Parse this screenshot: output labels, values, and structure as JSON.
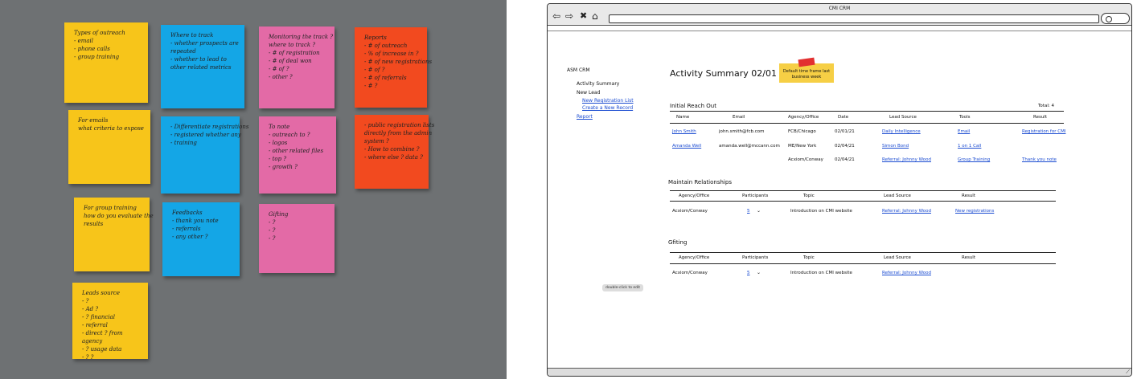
{
  "photo": {
    "notes": [
      {
        "color": "yellow",
        "lines": [
          "Types of outreach",
          "- email",
          "- phone calls",
          "- group training"
        ]
      },
      {
        "color": "blue",
        "lines": [
          "Where to track",
          "- whether prospects are",
          "  repeated",
          "- whether to lead to",
          "  other related metrics"
        ]
      },
      {
        "color": "pink",
        "lines": [
          "Monitoring the track ?",
          "where to track ?",
          "- # of registration",
          "- # of deal won",
          "- # of ?",
          "- other ?"
        ]
      },
      {
        "color": "red",
        "lines": [
          "Reports",
          "- # of outreach",
          "- % of increase in ?",
          "- # of new registrations",
          "- # of ?",
          "- # of referrals",
          "- # ?"
        ]
      },
      {
        "color": "yellow",
        "lines": [
          "For emails",
          "what criteria to expose"
        ]
      },
      {
        "color": "blue",
        "lines": [
          "- Differentiate registrations",
          "- registered whether any",
          "- training"
        ]
      },
      {
        "color": "pink",
        "lines": [
          "To note",
          "- outreach to ?",
          "- logos",
          "- other related files",
          "- top ?",
          "- growth ?"
        ]
      },
      {
        "color": "red",
        "lines": [
          "- public registration lists",
          "  directly from the admin",
          "  system ?",
          "- How to combine ?",
          "- where else ? data ?"
        ]
      },
      {
        "color": "yellow",
        "lines": [
          "For group training",
          "how do you evaluate the",
          "results"
        ]
      },
      {
        "color": "blue",
        "lines": [
          "Feedbacks",
          "- thank you note",
          "- referrals",
          "- any other ?"
        ]
      },
      {
        "color": "pink",
        "lines": [
          "Gifting",
          "- ?",
          "- ?",
          "- ?"
        ]
      },
      {
        "color": "yellow",
        "lines": [
          "Leads source",
          "- ?",
          "- Ad ?",
          "- ? financial",
          "- referral",
          "- direct ? from",
          "  agency",
          "- ? usage data",
          "- ? ?"
        ]
      }
    ]
  },
  "browser": {
    "title": "CMI CRM",
    "nav_icons": [
      "back-arrow-icon",
      "forward-arrow-icon",
      "close-x-icon",
      "home-icon"
    ],
    "url": ""
  },
  "sidebar": {
    "app_name": "ASM CRM",
    "activity_summary": "Activity Summary",
    "new_lead": "New Lead",
    "new_registration_list": "New Registration List",
    "create_new_record": "Create a New Record",
    "report": "Report"
  },
  "main": {
    "title": "Activity Summary  02/01 - 02/05",
    "sticky_note": "Default time frame last business week",
    "initial_reach_out": {
      "heading": "Initial Reach Out",
      "total": "Total: 4",
      "columns": [
        "Name",
        "Email",
        "Agency/Office",
        "Date",
        "Lead Source",
        "Tools",
        "Result"
      ],
      "rows": [
        [
          "John Smith",
          "john.smith@fcb.com",
          "FCB/Chicago",
          "02/01/21",
          "Daily Intelligence",
          "Email",
          "Registration for CMI"
        ],
        [
          "Amanda Well",
          "amanda.well@mccann.com",
          "ME/New York",
          "02/04/21",
          "Simon Bond",
          "1 on 1 Call",
          ""
        ],
        [
          "",
          "",
          "Acxiom/Conway",
          "02/04/21",
          "Referral: Johnny Wood",
          "Group Training",
          "Thank you note"
        ]
      ]
    },
    "maintain": {
      "heading": "Maintain Relationships",
      "columns": [
        "Agency/Office",
        "Participants",
        "Topic",
        "Lead Source",
        "Result"
      ],
      "rows": [
        [
          "Acxiom/Conway",
          "5",
          "Introduction on CMI website",
          "Referral: Johnny Wood",
          "New registrations"
        ]
      ]
    },
    "gifting": {
      "heading": "Gfiting",
      "columns": [
        "Agency/Office",
        "Participants",
        "Topic",
        "Lead Source",
        "Result"
      ],
      "rows": [
        [
          "Acxiom/Conway",
          "5",
          "Introduction on CMI website",
          "Referral: Johnny Wood",
          ""
        ]
      ]
    },
    "edit_hint": "double-click to edit"
  }
}
